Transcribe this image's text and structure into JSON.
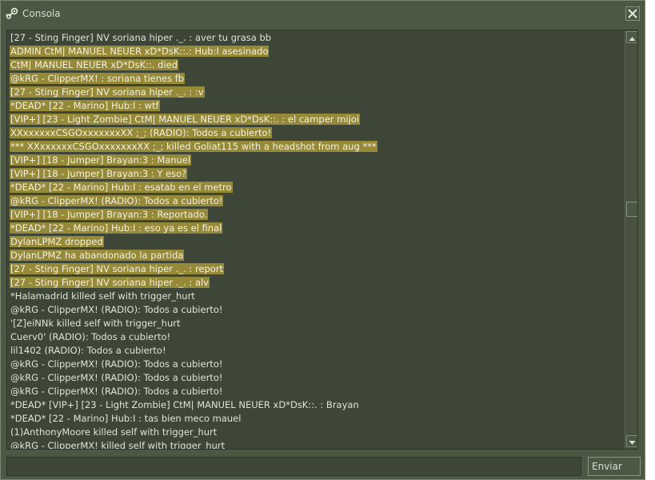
{
  "window": {
    "title": "Consola",
    "icon": "steam-icon",
    "close_icon": "close-icon"
  },
  "colors": {
    "background": "#4c5844",
    "log_background": "#3e4637",
    "highlight": "#968a39",
    "text": "#dfe4d9"
  },
  "console": {
    "lines": [
      {
        "text": "[27 - Sting Finger] NV soriana hiper ._. : aver tu grasa bb",
        "highlighted": false
      },
      {
        "text": "ADMIN CtM| MANUEL NEUER xD*DsK::.: Hub:I asesinado",
        "highlighted": true
      },
      {
        "text": "CtM| MANUEL NEUER xD*DsK::. died",
        "highlighted": true
      },
      {
        "text": "@kRG - ClipperMX! :   soriana tienes fb",
        "highlighted": true
      },
      {
        "text": "[27 - Sting Finger] NV soriana hiper ._. : :v",
        "highlighted": true
      },
      {
        "text": "*DEAD* [22 - Marino] Hub:I : wtf",
        "highlighted": true
      },
      {
        "text": "[VIP+] [23 - Light Zombie] CtM| MANUEL NEUER xD*DsK::. : el camper mijoi",
        "highlighted": true
      },
      {
        "text": "XXxxxxxxCSGOxxxxxxxXX ;_; (RADIO): Todos a cubierto!",
        "highlighted": true
      },
      {
        "text": "*** XXxxxxxxCSGOxxxxxxxXX ;_; killed Goliat115 with a headshot from aug ***",
        "highlighted": true
      },
      {
        "text": "[VIP+] [18 - Jumper] Brayan:3 : Manuel",
        "highlighted": true
      },
      {
        "text": "[VIP+] [18 - Jumper] Brayan:3 : Y eso?",
        "highlighted": true
      },
      {
        "text": "*DEAD* [22 - Marino] Hub:I : esatab en el metro",
        "highlighted": true
      },
      {
        "text": "@kRG - ClipperMX! (RADIO): Todos a cubierto!",
        "highlighted": true
      },
      {
        "text": "[VIP+] [18 - Jumper] Brayan:3 : Reportado.",
        "highlighted": true
      },
      {
        "text": "*DEAD* [22 - Marino] Hub:I : eso ya es el final",
        "highlighted": true
      },
      {
        "text": "DylanLPMZ dropped",
        "highlighted": true
      },
      {
        "text": "DylanLPMZ ha abandonado la partida",
        "highlighted": true
      },
      {
        "text": "[27 - Sting Finger] NV soriana hiper ._. : report",
        "highlighted": true
      },
      {
        "text": "[27 - Sting Finger] NV soriana hiper ._. : alv",
        "highlighted": true
      },
      {
        "text": "*Halamadrid killed self with trigger_hurt",
        "highlighted": false
      },
      {
        "text": "@kRG - ClipperMX! (RADIO): Todos a cubierto!",
        "highlighted": false
      },
      {
        "text": "'[Z]eiNNk killed self with trigger_hurt",
        "highlighted": false
      },
      {
        "text": "Cuerv0' (RADIO): Todos a cubierto!",
        "highlighted": false
      },
      {
        "text": "lil1402 (RADIO): Todos a cubierto!",
        "highlighted": false
      },
      {
        "text": "@kRG - ClipperMX! (RADIO): Todos a cubierto!",
        "highlighted": false
      },
      {
        "text": "@kRG - ClipperMX! (RADIO): Todos a cubierto!",
        "highlighted": false
      },
      {
        "text": "@kRG - ClipperMX! (RADIO): Todos a cubierto!",
        "highlighted": false
      },
      {
        "text": "*DEAD* [VIP+] [23 - Light Zombie] CtM| MANUEL NEUER xD*DsK::. : Brayan",
        "highlighted": false
      },
      {
        "text": "*DEAD* [22 - Marino] Hub:I : tas bien meco mauel",
        "highlighted": false
      },
      {
        "text": "(1)AnthonyMoore killed self with trigger_hurt",
        "highlighted": false
      },
      {
        "text": "@kRG - ClipperMX! killed self with trigger_hurt",
        "highlighted": false
      }
    ],
    "scroll_position": 0.42
  },
  "input": {
    "value": "",
    "placeholder": ""
  },
  "send_button": {
    "label": "Enviar"
  }
}
